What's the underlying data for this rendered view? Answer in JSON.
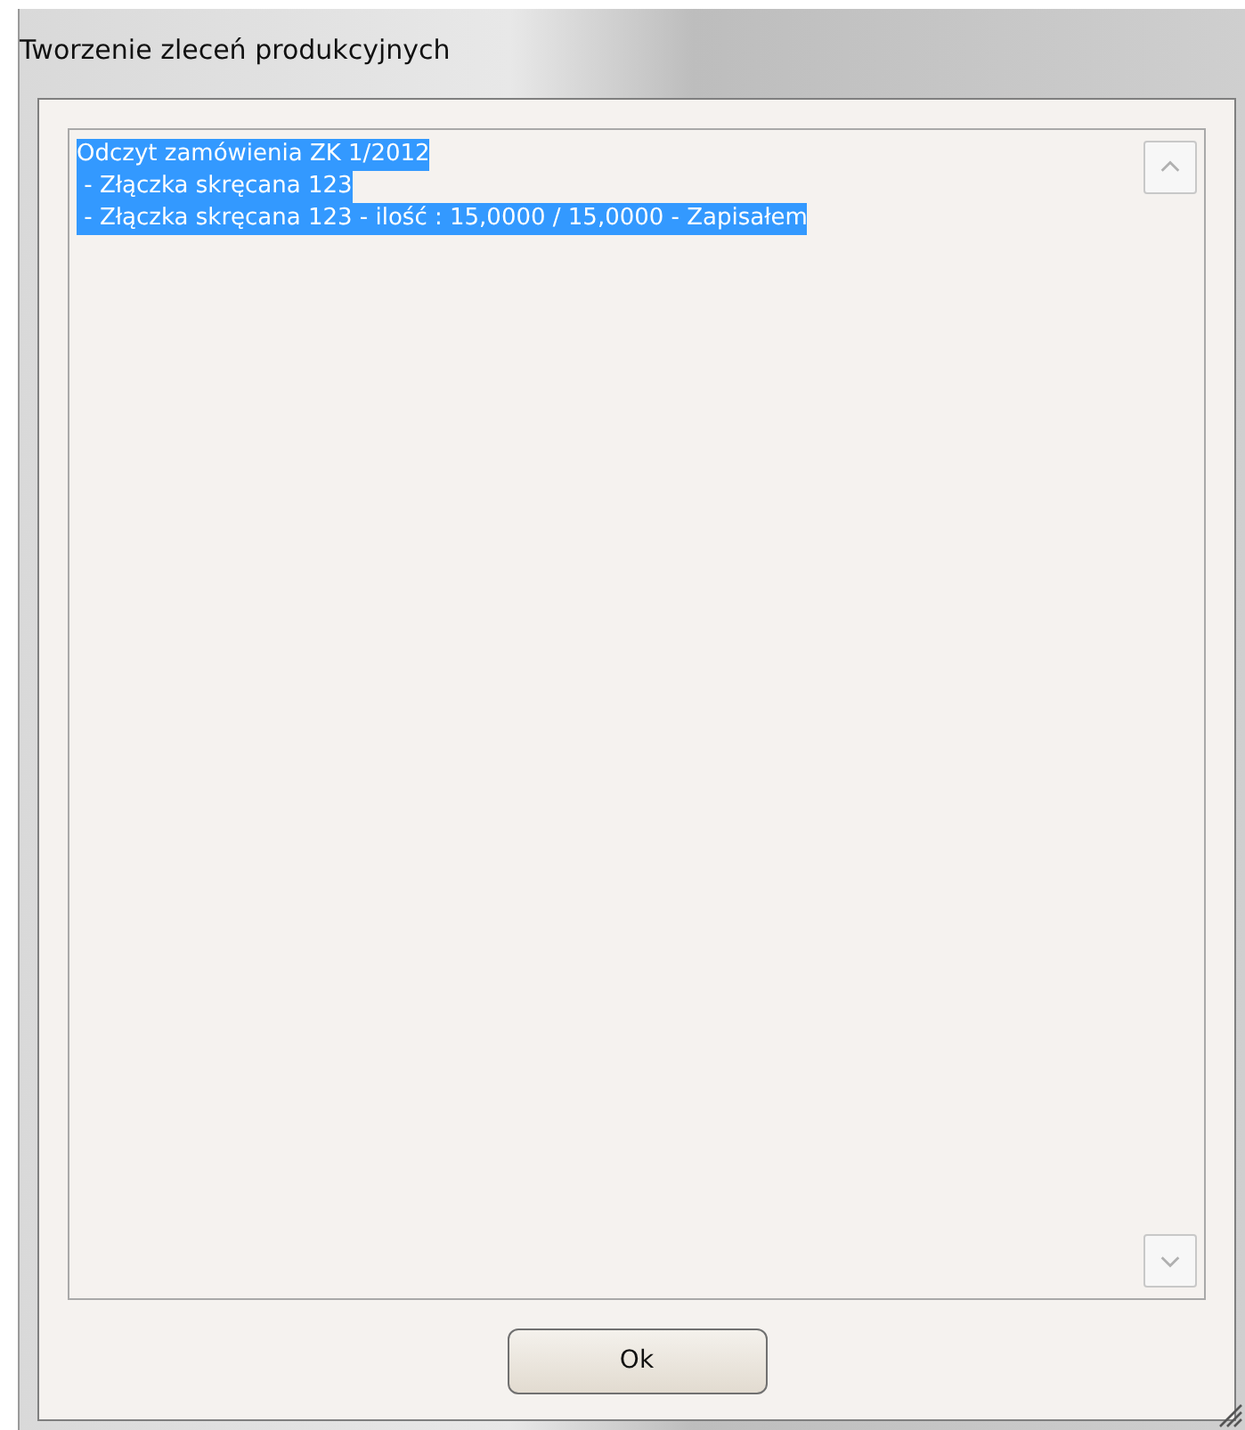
{
  "window": {
    "title": "Tworzenie zleceń produkcyjnych"
  },
  "log": {
    "lines": [
      {
        "text": "Odczyt zamówienia ZK 1/2012",
        "selected": true
      },
      {
        "text": " - Złączka skręcana 123",
        "selected": true
      },
      {
        "text": " - Złączka skręcana 123 - ilość : 15,0000 / 15,0000 - Zapisałem",
        "selected": true
      }
    ]
  },
  "buttons": [
    {
      "label": "Ok"
    }
  ]
}
